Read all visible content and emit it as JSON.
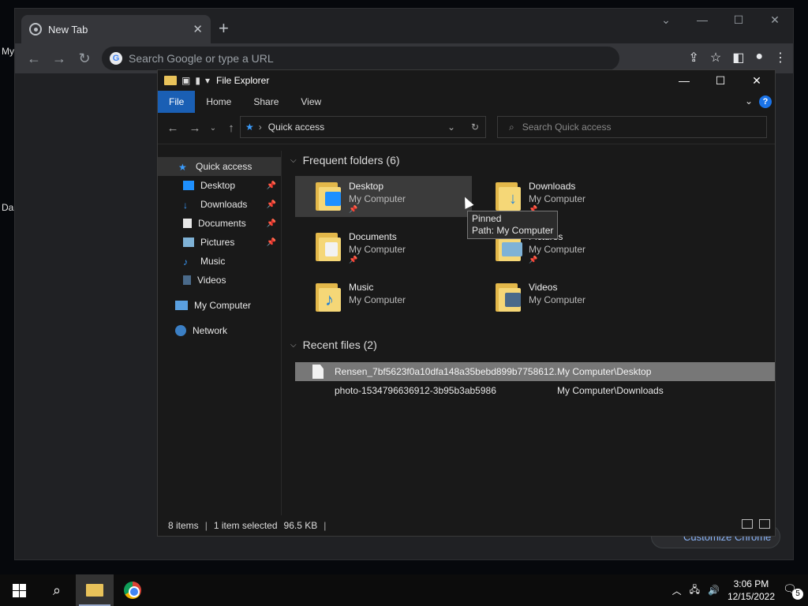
{
  "desktop": {
    "label_top": "My",
    "label_mid": "Da"
  },
  "chrome": {
    "tab_title": "New Tab",
    "omnibox_placeholder": "Search Google or type a URL",
    "customize_label": "Customize Chrome"
  },
  "explorer": {
    "title": "File Explorer",
    "ribbon_tabs": [
      "File",
      "Home",
      "Share",
      "View"
    ],
    "address_text": "Quick access",
    "search_placeholder": "Search Quick access",
    "nav_items": [
      {
        "label": "Quick access",
        "icon": "star-icon",
        "pinned": false
      },
      {
        "label": "Desktop",
        "icon": "desktop-icon",
        "pinned": true
      },
      {
        "label": "Downloads",
        "icon": "download-icon",
        "pinned": true
      },
      {
        "label": "Documents",
        "icon": "document-icon",
        "pinned": true
      },
      {
        "label": "Pictures",
        "icon": "picture-icon",
        "pinned": true
      },
      {
        "label": "Music",
        "icon": "music-icon",
        "pinned": false
      },
      {
        "label": "Videos",
        "icon": "video-icon",
        "pinned": false
      },
      {
        "label": "My Computer",
        "icon": "computer-icon",
        "pinned": false
      },
      {
        "label": "Network",
        "icon": "network-icon",
        "pinned": false
      }
    ],
    "frequent_header": "Frequent folders (6)",
    "folders": [
      {
        "name": "Desktop",
        "location": "My Computer",
        "pinned": true,
        "badge_color": "#1e90ff"
      },
      {
        "name": "Downloads",
        "location": "My Computer",
        "pinned": true,
        "badge_color": "#2b88d8"
      },
      {
        "name": "Documents",
        "location": "My Computer",
        "pinned": true,
        "badge_color": "#f2f2f2"
      },
      {
        "name": "Pictures",
        "location": "My Computer",
        "pinned": true,
        "badge_color": "#7fb2d6"
      },
      {
        "name": "Music",
        "location": "My Computer",
        "pinned": false,
        "badge_color": "#1e7fd8"
      },
      {
        "name": "Videos",
        "location": "My Computer",
        "pinned": false,
        "badge_color": "#4a6a8a"
      }
    ],
    "tooltip": {
      "line1": "Pinned",
      "line2": "Path: My Computer"
    },
    "recent_header": "Recent files (2)",
    "recent_files": [
      {
        "name": "Rensen_7bf5623f0a10dfa148a35bebd899b7758612...",
        "path": "My Computer\\Desktop"
      },
      {
        "name": "photo-1534796636912-3b95b3ab5986",
        "path": "My Computer\\Downloads"
      }
    ],
    "status": {
      "items": "8 items",
      "selected": "1 item selected",
      "size": "96.5 KB"
    }
  },
  "taskbar": {
    "time": "3:06 PM",
    "date": "12/15/2022",
    "notifications": "5"
  }
}
